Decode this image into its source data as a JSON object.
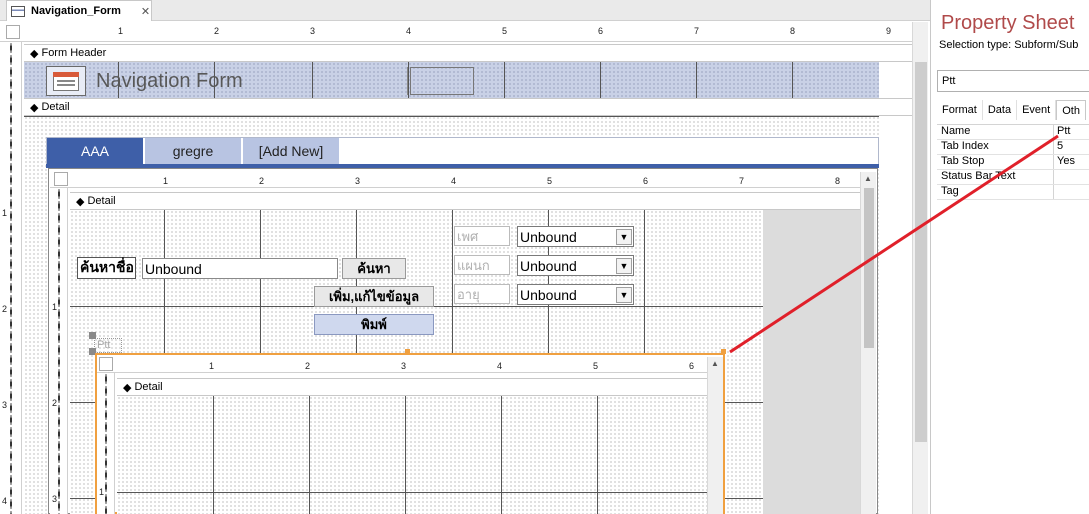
{
  "document_tab": {
    "title": "Navigation_Form",
    "close": "✕"
  },
  "sections": {
    "form_header": "Form Header",
    "detail": "Detail",
    "sub_detail": "Detail",
    "sub2_detail": "Detail"
  },
  "form_title": "Navigation Form",
  "nav_tabs": [
    "AAA",
    "gregre",
    "[Add New]"
  ],
  "subform1": {
    "search_label": "ค้นหาชื่อ",
    "search_value": "Unbound",
    "search_button": "ค้นหา",
    "edit_button": "เพิ่ม,แก้ไขข้อมูล",
    "print_button": "พิมพ์",
    "combo_labels": [
      "เพศ",
      "แผนก",
      "อายุ"
    ],
    "combo_values": [
      "Unbound",
      "Unbound",
      "Unbound"
    ],
    "subform_label": "Ptt"
  },
  "ruler_numbers": [
    "1",
    "2",
    "3",
    "4",
    "5",
    "6",
    "7",
    "8",
    "9"
  ],
  "sub_ruler_numbers": [
    "1",
    "2",
    "3",
    "4",
    "5",
    "6",
    "7",
    "8"
  ],
  "sub2_ruler_numbers": [
    "1",
    "2",
    "3",
    "4",
    "5",
    "6"
  ],
  "vruler_numbers": [
    "1",
    "2",
    "3",
    "4"
  ],
  "sub_vruler_numbers": [
    "1",
    "2",
    "3"
  ],
  "sub2_vruler_numbers": [
    "1"
  ],
  "property_sheet": {
    "title": "Property Sheet",
    "selection_type": "Selection type:  Subform/Sub",
    "selected_object": "Ptt",
    "tabs": [
      "Format",
      "Data",
      "Event",
      "Oth"
    ],
    "rows": [
      {
        "name": "Name",
        "value": "Ptt"
      },
      {
        "name": "Tab Index",
        "value": "5"
      },
      {
        "name": "Tab Stop",
        "value": "Yes"
      },
      {
        "name": "Status Bar Text",
        "value": ""
      },
      {
        "name": "Tag",
        "value": ""
      }
    ]
  },
  "colors": {
    "nav_active": "#3e5fa8",
    "nav_inactive": "#b8c4e2",
    "subform_selection": "#f0a040",
    "arrow": "#e0202a"
  }
}
